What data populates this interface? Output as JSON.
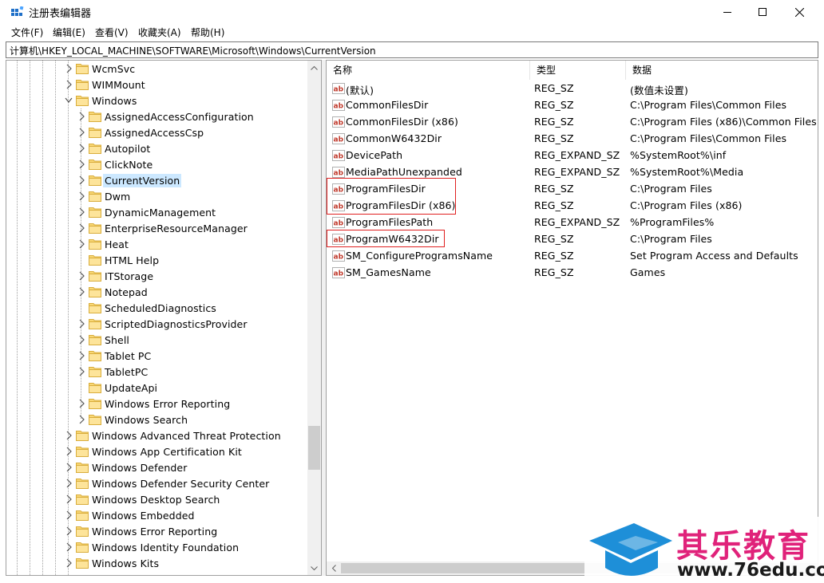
{
  "window": {
    "title": "注册表编辑器",
    "controls": {
      "minimize": "minimize-icon",
      "maximize": "maximize-icon",
      "close": "close-icon"
    }
  },
  "menu": [
    "文件(F)",
    "编辑(E)",
    "查看(V)",
    "收藏夹(A)",
    "帮助(H)"
  ],
  "address": "计算机\\HKEY_LOCAL_MACHINE\\SOFTWARE\\Microsoft\\Windows\\CurrentVersion",
  "tree": {
    "items": [
      {
        "label": "WcmSvc",
        "level": 1,
        "expander": "collapsed"
      },
      {
        "label": "WIMMount",
        "level": 1,
        "expander": "collapsed"
      },
      {
        "label": "Windows",
        "level": 1,
        "expander": "expanded"
      },
      {
        "label": "AssignedAccessConfiguration",
        "level": 2,
        "expander": "collapsed"
      },
      {
        "label": "AssignedAccessCsp",
        "level": 2,
        "expander": "collapsed"
      },
      {
        "label": "Autopilot",
        "level": 2,
        "expander": "collapsed"
      },
      {
        "label": "ClickNote",
        "level": 2,
        "expander": "collapsed"
      },
      {
        "label": "CurrentVersion",
        "level": 2,
        "expander": "collapsed",
        "selected": true
      },
      {
        "label": "Dwm",
        "level": 2,
        "expander": "collapsed"
      },
      {
        "label": "DynamicManagement",
        "level": 2,
        "expander": "collapsed"
      },
      {
        "label": "EnterpriseResourceManager",
        "level": 2,
        "expander": "collapsed"
      },
      {
        "label": "Heat",
        "level": 2,
        "expander": "collapsed"
      },
      {
        "label": "HTML Help",
        "level": 2,
        "expander": "none"
      },
      {
        "label": "ITStorage",
        "level": 2,
        "expander": "collapsed"
      },
      {
        "label": "Notepad",
        "level": 2,
        "expander": "collapsed"
      },
      {
        "label": "ScheduledDiagnostics",
        "level": 2,
        "expander": "none"
      },
      {
        "label": "ScriptedDiagnosticsProvider",
        "level": 2,
        "expander": "collapsed"
      },
      {
        "label": "Shell",
        "level": 2,
        "expander": "collapsed"
      },
      {
        "label": "Tablet PC",
        "level": 2,
        "expander": "collapsed"
      },
      {
        "label": "TabletPC",
        "level": 2,
        "expander": "collapsed"
      },
      {
        "label": "UpdateApi",
        "level": 2,
        "expander": "none"
      },
      {
        "label": "Windows Error Reporting",
        "level": 2,
        "expander": "collapsed"
      },
      {
        "label": "Windows Search",
        "level": 2,
        "expander": "collapsed"
      },
      {
        "label": "Windows Advanced Threat Protection",
        "level": 1,
        "expander": "collapsed"
      },
      {
        "label": "Windows App Certification Kit",
        "level": 1,
        "expander": "collapsed"
      },
      {
        "label": "Windows Defender",
        "level": 1,
        "expander": "collapsed"
      },
      {
        "label": "Windows Defender Security Center",
        "level": 1,
        "expander": "collapsed"
      },
      {
        "label": "Windows Desktop Search",
        "level": 1,
        "expander": "collapsed"
      },
      {
        "label": "Windows Embedded",
        "level": 1,
        "expander": "collapsed"
      },
      {
        "label": "Windows Error Reporting",
        "level": 1,
        "expander": "collapsed"
      },
      {
        "label": "Windows Identity Foundation",
        "level": 1,
        "expander": "collapsed"
      },
      {
        "label": "Windows Kits",
        "level": 1,
        "expander": "collapsed"
      }
    ]
  },
  "list": {
    "columns": [
      "名称",
      "类型",
      "数据"
    ],
    "values": [
      {
        "name": "(默认)",
        "type": "REG_SZ",
        "data": "(数值未设置)"
      },
      {
        "name": "CommonFilesDir",
        "type": "REG_SZ",
        "data": "C:\\Program Files\\Common Files"
      },
      {
        "name": "CommonFilesDir (x86)",
        "type": "REG_SZ",
        "data": "C:\\Program Files (x86)\\Common Files"
      },
      {
        "name": "CommonW6432Dir",
        "type": "REG_SZ",
        "data": "C:\\Program Files\\Common Files"
      },
      {
        "name": "DevicePath",
        "type": "REG_EXPAND_SZ",
        "data": "%SystemRoot%\\inf"
      },
      {
        "name": "MediaPathUnexpanded",
        "type": "REG_EXPAND_SZ",
        "data": "%SystemRoot%\\Media"
      },
      {
        "name": "ProgramFilesDir",
        "type": "REG_SZ",
        "data": "C:\\Program Files"
      },
      {
        "name": "ProgramFilesDir (x86)",
        "type": "REG_SZ",
        "data": "C:\\Program Files (x86)"
      },
      {
        "name": "ProgramFilesPath",
        "type": "REG_EXPAND_SZ",
        "data": "%ProgramFiles%"
      },
      {
        "name": "ProgramW6432Dir",
        "type": "REG_SZ",
        "data": "C:\\Program Files"
      },
      {
        "name": "SM_ConfigureProgramsName",
        "type": "REG_SZ",
        "data": "Set Program Access and Defaults"
      },
      {
        "name": "SM_GamesName",
        "type": "REG_SZ",
        "data": "Games"
      }
    ],
    "value_icon": "ab-string-icon",
    "value_icon_text": "ab"
  },
  "watermark": {
    "text_cn": "其乐教育",
    "url": "www.76edu.com",
    "icon": "graduation-cap-icon"
  },
  "colors": {
    "selection": "#cce8ff",
    "folder": "#f8d775",
    "highlight_box": "#e02020",
    "watermark_pink": "#e0227a",
    "watermark_blue": "#1e8fd8"
  }
}
